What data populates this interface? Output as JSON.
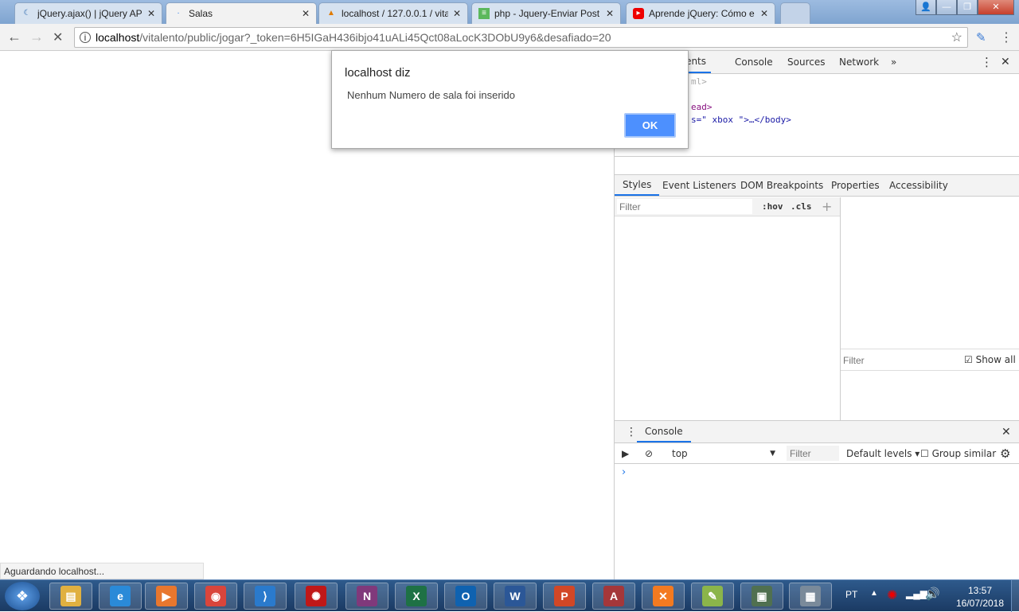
{
  "browser": {
    "tabs": [
      {
        "title": "jQuery.ajax() | jQuery API",
        "icon": "jquery-icon"
      },
      {
        "title": "Salas",
        "icon": "loading-icon",
        "active": true
      },
      {
        "title": "localhost / 127.0.0.1 / vita",
        "icon": "phpmyadmin-icon"
      },
      {
        "title": "php - Jquery-Enviar Post",
        "icon": "stackoverflow-icon"
      },
      {
        "title": "Aprende jQuery: Cómo e",
        "icon": "youtube-icon"
      }
    ],
    "url_host": "localhost",
    "url_path": "/vitalento/public/jogar?_token=6H5IGaH436ibjo41uALi45Qct08aLocK3DObU9y6&desafiado=20",
    "status": "Aguardando localhost..."
  },
  "dialog": {
    "title": "localhost diz",
    "message": "Nenhum Numero de sala foi inserido",
    "ok": "OK"
  },
  "devtools": {
    "tabs": [
      "ements",
      "Console",
      "Sources",
      "Network"
    ],
    "tree": [
      "ml>",
      "ead>",
      "s=\" xbox \">…</body>"
    ],
    "sidebar_tabs": [
      "Styles",
      "Event Listeners",
      "DOM Breakpoints",
      "Properties",
      "Accessibility"
    ],
    "filter_placeholder": "Filter",
    "hov": ":hov",
    "cls": ".cls",
    "computed_filter": "Filter",
    "show_all": "Show all",
    "drawer_tab": "Console",
    "context": "top",
    "console_filter": "Filter",
    "levels": "Default levels ▾",
    "group_similar": "Group similar"
  },
  "taskbar": {
    "lang": "PT",
    "time": "13:57",
    "date": "16/07/2018",
    "apps": [
      {
        "name": "explorer",
        "label": "▤",
        "color": "#e0b040"
      },
      {
        "name": "internet-explorer",
        "label": "e",
        "color": "#2a8ad8"
      },
      {
        "name": "media-player",
        "label": "▶",
        "color": "#e8772e"
      },
      {
        "name": "chrome",
        "label": "◉",
        "color": "#d9453b"
      },
      {
        "name": "vscode",
        "label": "⟩",
        "color": "#2a7acc"
      },
      {
        "name": "app-red",
        "label": "✺",
        "color": "#c01818"
      },
      {
        "name": "onenote",
        "label": "N",
        "color": "#80397b"
      },
      {
        "name": "excel",
        "label": "X",
        "color": "#1e7145"
      },
      {
        "name": "outlook",
        "label": "O",
        "color": "#0f62b0"
      },
      {
        "name": "word",
        "label": "W",
        "color": "#2b5797"
      },
      {
        "name": "powerpoint",
        "label": "P",
        "color": "#d24726"
      },
      {
        "name": "access",
        "label": "A",
        "color": "#a4373a"
      },
      {
        "name": "xampp",
        "label": "✕",
        "color": "#f37a20"
      },
      {
        "name": "notepad-plus",
        "label": "✎",
        "color": "#8bb54a"
      },
      {
        "name": "terminal",
        "label": "▣",
        "color": "#507050"
      },
      {
        "name": "calculator",
        "label": "▦",
        "color": "#7a8a9a"
      }
    ]
  }
}
